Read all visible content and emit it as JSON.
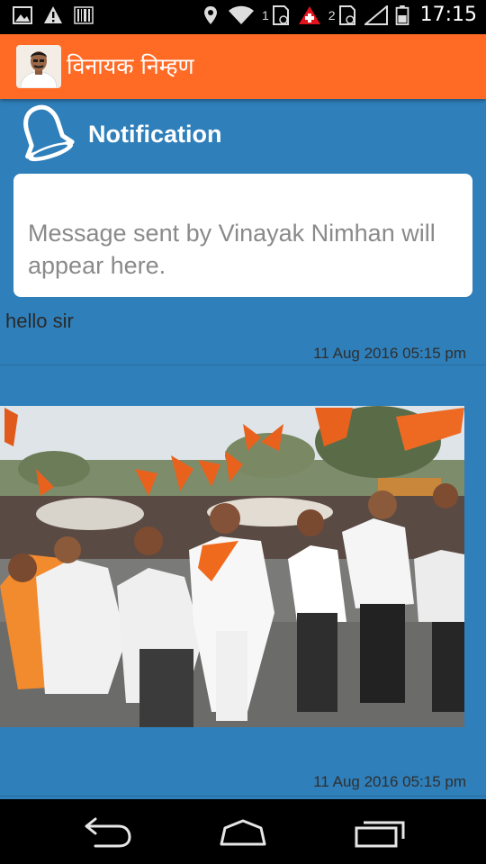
{
  "status_bar": {
    "sim1_label": "1",
    "sim2_label": "2",
    "time": "17:15",
    "icons": [
      "image-icon",
      "warning-icon",
      "barcode-icon",
      "location-icon",
      "wifi-icon",
      "sim1-icon",
      "medical-icon",
      "sim2-icon",
      "signal-icon",
      "battery-icon"
    ]
  },
  "app_bar": {
    "title": "विनायक निम्हण",
    "avatar": "profile-avatar"
  },
  "notification": {
    "title": "Notification",
    "icon": "bell-icon",
    "info_text": "Message sent by Vinayak Nimhan will appear here."
  },
  "messages": [
    {
      "text": "hello sir",
      "timestamp": "11 Aug 2016 05:15 pm"
    },
    {
      "image": "rally-photo",
      "timestamp": "11 Aug 2016 05:15 pm"
    }
  ],
  "nav_bar": {
    "icons": [
      "back-icon",
      "home-icon",
      "recent-apps-icon"
    ]
  },
  "colors": {
    "app_bar": "#ff6a25",
    "background": "#2f7fba",
    "card": "#ffffff",
    "status_bar": "#000000"
  }
}
